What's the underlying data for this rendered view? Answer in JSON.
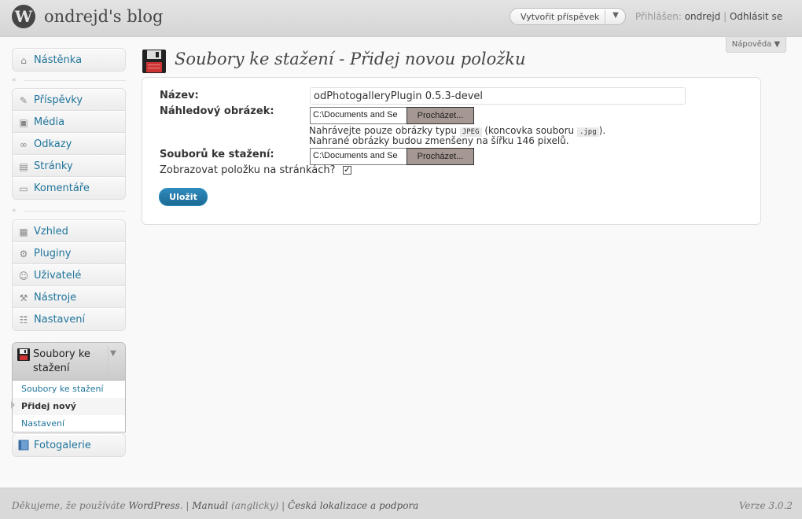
{
  "header": {
    "logo_letter": "W",
    "site_title": "ondrejd's blog",
    "favorite_actions_label": "Vytvořit příspěvek",
    "favorite_actions_arrow": "▼",
    "logged_in_prefix": "Přihlášen:",
    "username": "ondrejd",
    "separator": "|",
    "logout": "Odhlásit se"
  },
  "help_tab": "Nápověda ▼",
  "menu_groups": [
    {
      "items": [
        {
          "label": "Nástěnka",
          "icon": "home-icon",
          "glyph": "⌂"
        }
      ]
    },
    {
      "items": [
        {
          "label": "Příspěvky",
          "icon": "pin-icon",
          "glyph": "✎"
        },
        {
          "label": "Média",
          "icon": "media-icon",
          "glyph": "▣"
        },
        {
          "label": "Odkazy",
          "icon": "link-icon",
          "glyph": "∞"
        },
        {
          "label": "Stránky",
          "icon": "pages-icon",
          "glyph": "▤"
        },
        {
          "label": "Komentáře",
          "icon": "comment-icon",
          "glyph": "▭"
        }
      ]
    },
    {
      "items": [
        {
          "label": "Vzhled",
          "icon": "appearance-icon",
          "glyph": "▦"
        },
        {
          "label": "Pluginy",
          "icon": "plugin-icon",
          "glyph": "⚙"
        },
        {
          "label": "Uživatelé",
          "icon": "users-icon",
          "glyph": "☺"
        },
        {
          "label": "Nástroje",
          "icon": "tools-icon",
          "glyph": "⚒"
        },
        {
          "label": "Nastavení",
          "icon": "settings-icon",
          "glyph": "☷"
        }
      ]
    }
  ],
  "collapse_glyph": "«",
  "active_menu": {
    "label": "Soubory ke stažení",
    "toggle": "▼",
    "submenu": [
      {
        "label": "Soubory ke stažení"
      },
      {
        "label": "Přidej nový"
      },
      {
        "label": "Nastavení"
      }
    ]
  },
  "extra_menu_item": {
    "label": "Fotogalerie",
    "icon": "gallery-icon"
  },
  "page_title": "Soubory ke stažení - Přidej novou položku",
  "form": {
    "name_label": "Název:",
    "name_value": "odPhotogalleryPlugin 0.5.3-devel",
    "preview_label": "Náhledový obrázek:",
    "preview_file_value": "C:\\Documents and Se",
    "browse_label": "Procházet...",
    "hint_line1_a": "Nahrávejte pouze obrázky typu ",
    "hint_code1": "JPEG",
    "hint_line1_b": " (koncovka souboru ",
    "hint_code2": ".jpg",
    "hint_line1_c": ").",
    "hint_line2": "Nahrané obrázky budou zmenšeny na šířku 146 pixelů.",
    "download_label": "Souborů ke stažení:",
    "download_file_value": "C:\\Documents and Se",
    "show_label": "Zobrazovat položku na stránkách?",
    "show_checked": "✓",
    "save_label": "Uložit"
  },
  "footer": {
    "thanks_prefix": "Děkujeme, že používáte ",
    "wordpress": "WordPress",
    "dot": ".",
    "sep1": " | ",
    "manual": "Manuál",
    "manual_note": " (anglicky)",
    "sep2": " | ",
    "localization": "Česká lokalizace a podpora",
    "version": "Verze 3.0.2"
  }
}
